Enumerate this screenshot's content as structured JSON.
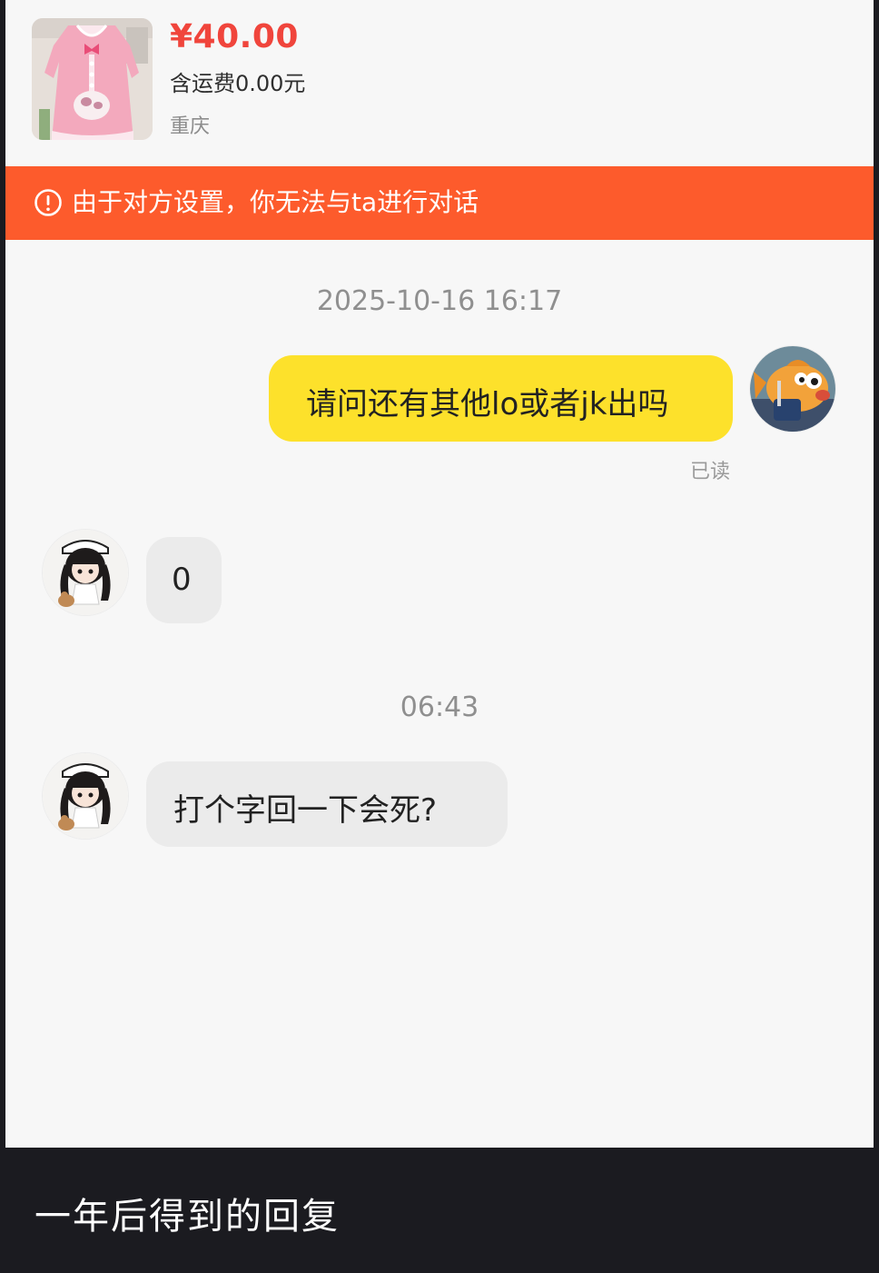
{
  "product": {
    "thumbnail_icon": "pink-lolita-dress-photo",
    "price": "¥40.00",
    "shipping": "含运费0.00元",
    "location": "重庆"
  },
  "banner": {
    "icon": "alert-circle-icon",
    "text": "由于对方设置，你无法与ta进行对话",
    "color": "#fd5b2c"
  },
  "conversation": {
    "timestamps": [
      "2025-10-16 16:17",
      "06:43"
    ],
    "messages": [
      {
        "from": "me",
        "avatar": "cartoon-fish-avatar",
        "text": "请问还有其他lo或者jk出吗",
        "status": "已读"
      },
      {
        "from": "seller",
        "avatar": "doll-girl-avatar",
        "text": "0"
      },
      {
        "from": "seller",
        "avatar": "doll-girl-avatar",
        "text": "打个字回一下会死?"
      }
    ],
    "outgoing_bubble_color": "#fde12b",
    "incoming_bubble_color": "#ebebeb"
  },
  "caption": "一年后得到的回复"
}
